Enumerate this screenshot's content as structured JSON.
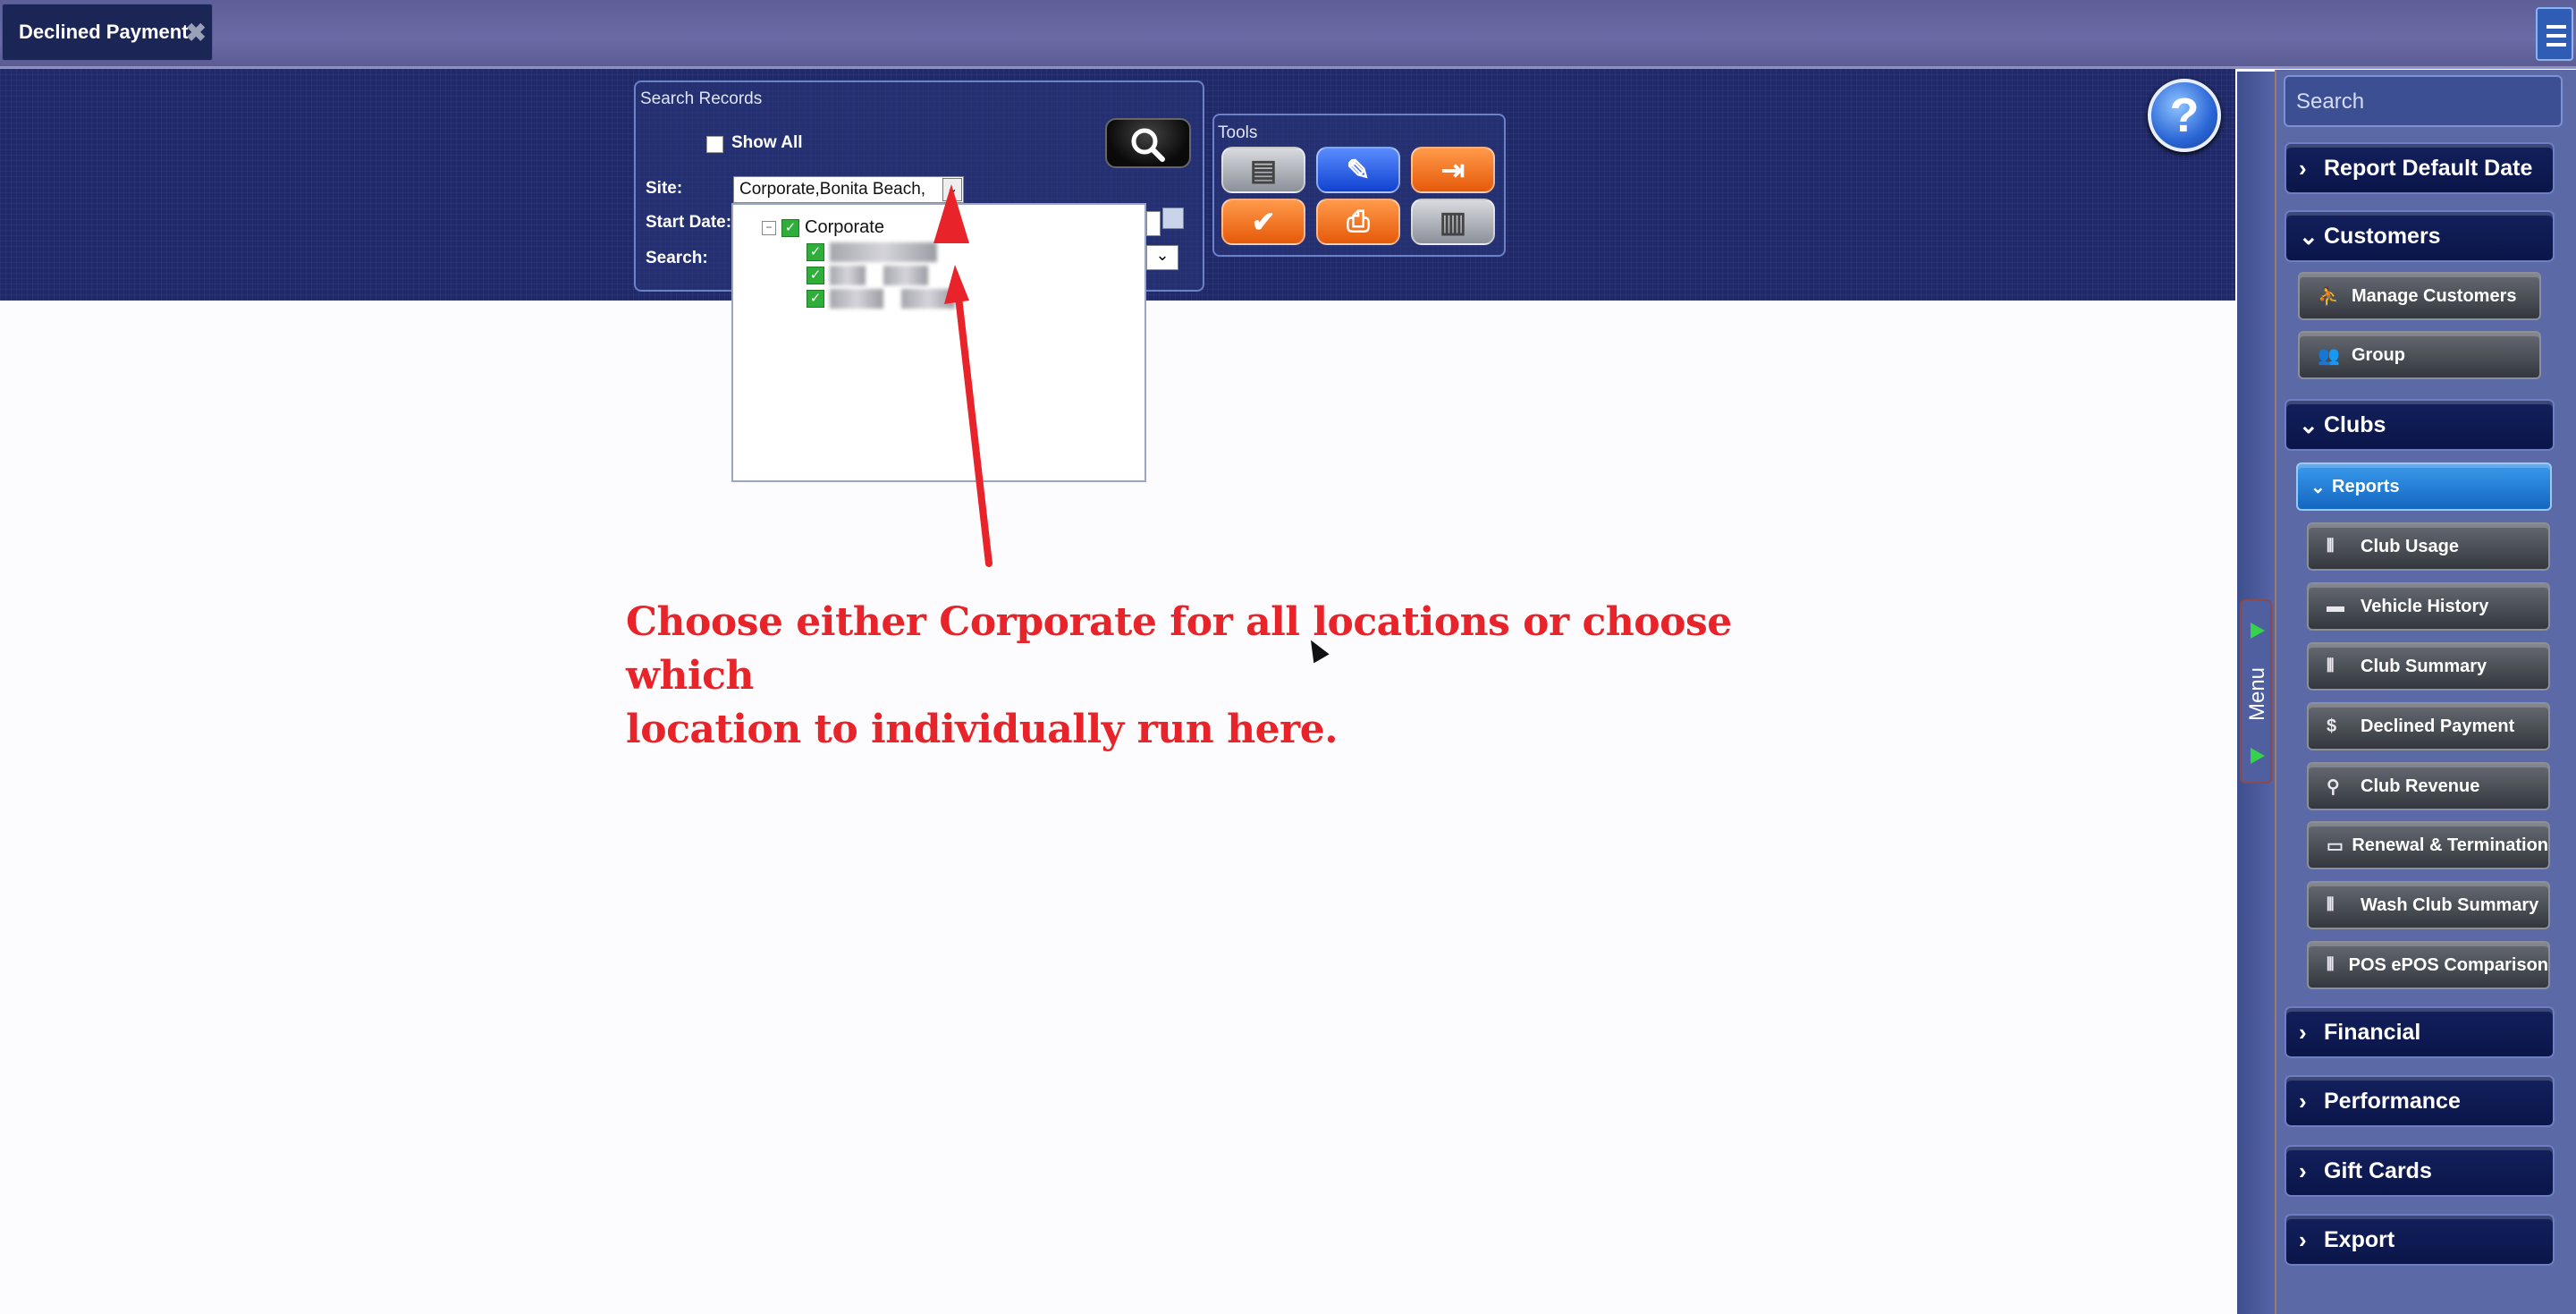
{
  "tab": {
    "title": "Declined Payment",
    "close_icon": "close-icon"
  },
  "search_records": {
    "group_label": "Search Records",
    "show_all_label": "Show All",
    "site_label": "Site:",
    "site_value": "Corporate,Bonita Beach,",
    "start_date_label": "Start Date:",
    "search_label": "Search:"
  },
  "tools": {
    "group_label": "Tools"
  },
  "site_tree": {
    "root": "Corporate",
    "children_obscured": [
      "Bonita Beach"
    ]
  },
  "annotation": {
    "line1": "Choose either Corporate for all locations or choose which",
    "line2": "location to individually run here.",
    "color": "#e8242a"
  },
  "sidebar": {
    "search_placeholder": "Search",
    "menu_label": "Menu",
    "report_default_date": "Report Default Date",
    "customers": {
      "label": "Customers",
      "items": [
        "Manage Customers",
        "Group"
      ]
    },
    "clubs": {
      "label": "Clubs",
      "reports_label": "Reports",
      "items": [
        "Club Usage",
        "Vehicle History",
        "Club Summary",
        "Declined Payment",
        "Club Revenue",
        "Renewal & Termination",
        "Wash Club Summary",
        "POS ePOS Comparison"
      ]
    },
    "financial": "Financial",
    "performance": "Performance",
    "gift_cards": "Gift Cards",
    "export": "Export"
  },
  "colors": {
    "header_bg": "#202a6a",
    "section_bg": "#0a1549",
    "selected_item": "#1466c0",
    "tool_orange": "#e55a0a",
    "tool_blue": "#1042d0"
  }
}
